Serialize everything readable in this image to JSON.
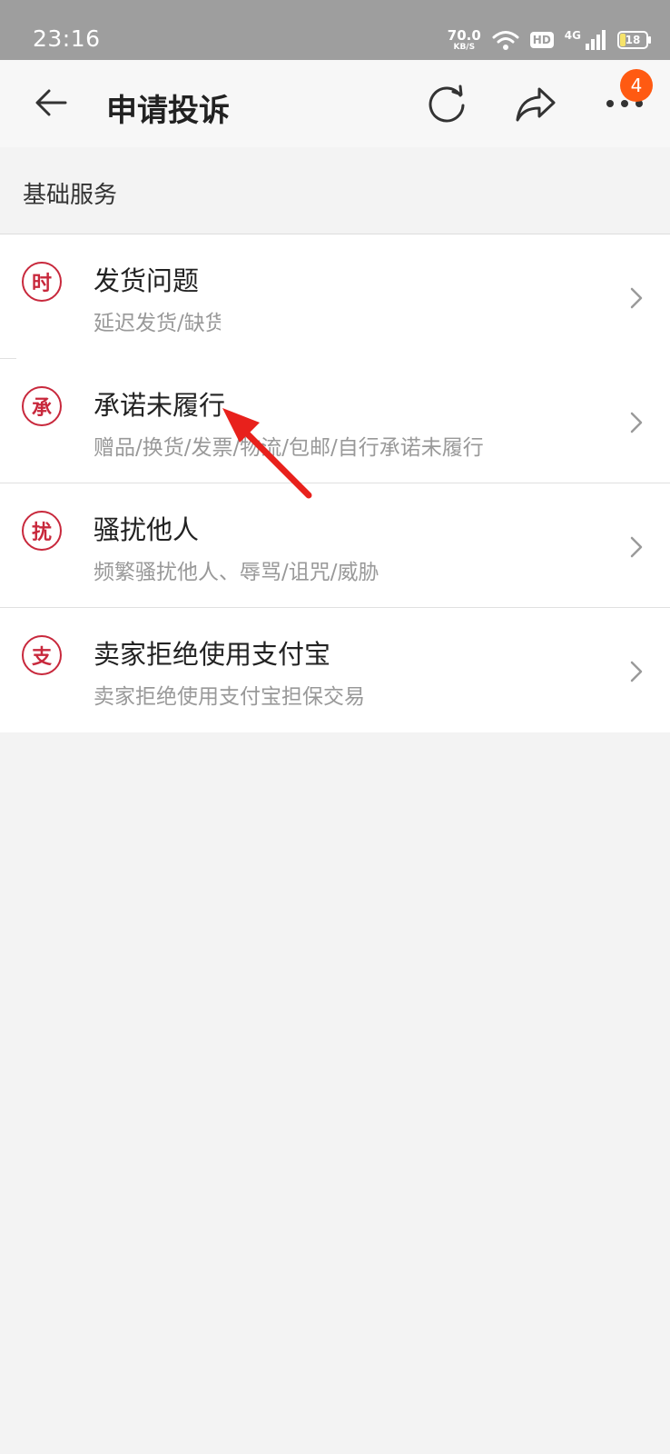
{
  "status": {
    "time": "23:16",
    "net_speed": "70.0",
    "net_unit": "KB/S",
    "hd": "HD",
    "signal": "4G",
    "battery": "18"
  },
  "appbar": {
    "title": "申请投诉",
    "badge": "4"
  },
  "section": {
    "title": "基础服务"
  },
  "items": [
    {
      "icon": "时",
      "title": "发货问题",
      "subtitle": "延迟发货/缺货"
    },
    {
      "icon": "承",
      "title": "承诺未履行",
      "subtitle": "赠品/换货/发票/物流/包邮/自行承诺未履行"
    },
    {
      "icon": "扰",
      "title": "骚扰他人",
      "subtitle": "频繁骚扰他人、辱骂/诅咒/威胁"
    },
    {
      "icon": "支",
      "title": "卖家拒绝使用支付宝",
      "subtitle": "卖家拒绝使用支付宝担保交易"
    }
  ],
  "colors": {
    "accent": "#c8283c",
    "badge": "#ff5a12",
    "annotation_arrow": "#e8211c"
  }
}
